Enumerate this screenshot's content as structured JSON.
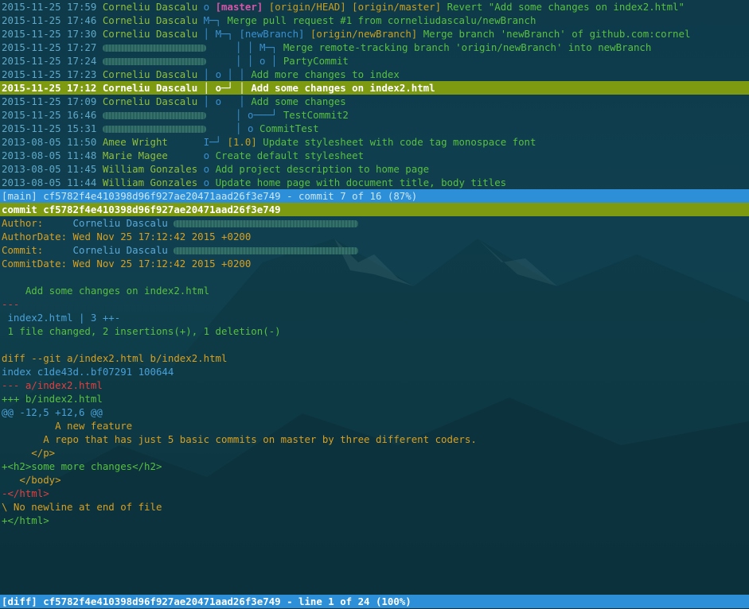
{
  "log": {
    "rows": [
      {
        "date": "2015-11-25 17:59",
        "author": "Corneliu Dascalu",
        "author_hidden": false,
        "graph": "o",
        "indent": "     ",
        "refs_head": "[master]",
        "refs": "[origin/HEAD] [origin/master]",
        "msg": "Revert \"Add some changes on index2.html\""
      },
      {
        "date": "2015-11-25 17:46",
        "author": "Corneliu Dascalu",
        "author_hidden": false,
        "graph": "M─┐",
        "indent": "     ",
        "refs_head": "",
        "refs": "",
        "msg": "Merge pull request #1 from corneliudascalu/newBranch"
      },
      {
        "date": "2015-11-25 17:30",
        "author": "Corneliu Dascalu",
        "author_hidden": false,
        "graph": "│ M─┐",
        "indent": "     ",
        "refs_head": "",
        "refs_blue": "[newBranch]",
        "refs": "[origin/newBranch]",
        "msg": "Merge branch 'newBranch' of github.com:cornel"
      },
      {
        "date": "2015-11-25 17:27",
        "author": "",
        "author_hidden": true,
        "graph": "│ │ M─┐",
        "indent": "     ",
        "refs_head": "",
        "refs": "",
        "msg": "Merge remote-tracking branch 'origin/newBranch' into newBranch"
      },
      {
        "date": "2015-11-25 17:24",
        "author": "",
        "author_hidden": true,
        "graph": "│ │ o │",
        "indent": "     ",
        "refs_head": "",
        "refs": "",
        "msg": "PartyCommit"
      },
      {
        "date": "2015-11-25 17:23",
        "author": "Corneliu Dascalu",
        "author_hidden": false,
        "graph": "│ o │ │",
        "indent": "     ",
        "refs_head": "",
        "refs": "",
        "msg": "Add more changes to index"
      },
      {
        "date": "2015-11-25 17:12",
        "author": "Corneliu Dascalu",
        "author_hidden": false,
        "graph": "│ o─┘ │",
        "indent": "     ",
        "refs_head": "",
        "refs": "",
        "msg": "Add some changes on index2.html",
        "selected": true
      },
      {
        "date": "2015-11-25 17:09",
        "author": "Corneliu Dascalu",
        "author_hidden": false,
        "graph": "│ o   │",
        "indent": "     ",
        "refs_head": "",
        "refs": "",
        "msg": "Add some changes"
      },
      {
        "date": "2015-11-25 16:46",
        "author": "",
        "author_hidden": true,
        "graph": "│ o───┘",
        "indent": "     ",
        "refs_head": "",
        "refs": "",
        "msg": "TestCommit2"
      },
      {
        "date": "2015-11-25 15:31",
        "author": "",
        "author_hidden": true,
        "graph": "│ o",
        "indent": "     ",
        "refs_head": "",
        "refs": "",
        "msg": "CommitTest"
      },
      {
        "date": "2013-08-05 11:50",
        "author": "Amee Wright",
        "author_hidden": false,
        "graph": "I─┘",
        "indent": "     ",
        "refs_head": "",
        "refs": "[1.0]",
        "msg": "Update stylesheet with code tag monospace font"
      },
      {
        "date": "2013-08-05 11:48",
        "author": "Marie Magee",
        "author_hidden": false,
        "graph": "o",
        "indent": "     ",
        "refs_head": "",
        "refs": "",
        "msg": "Create default stylesheet"
      },
      {
        "date": "2013-08-05 11:45",
        "author": "William Gonzales",
        "author_hidden": false,
        "graph": "o",
        "indent": "     ",
        "refs_head": "",
        "refs": "",
        "msg": "Add project description to home page"
      },
      {
        "date": "2013-08-05 11:44",
        "author": "William Gonzales",
        "author_hidden": false,
        "graph": "o",
        "indent": "     ",
        "refs_head": "",
        "refs": "",
        "msg": "Update home page with document title, body titles"
      }
    ]
  },
  "status_main": {
    "label": "[main] cf5782f4e410398d96f927ae20471aad26f3e749 - commit 7 of 16 (87%)"
  },
  "diff": {
    "commit_line": "commit cf5782f4e410398d96f927ae20471aad26f3e749",
    "author_label": "Author:",
    "author_name": "Corneliu Dascalu",
    "author_date_label": "AuthorDate:",
    "author_date": "Wed Nov 25 17:12:42 2015 +0200",
    "committer_label": "Commit:",
    "committer_name": "Corneliu Dascalu",
    "commit_date_label": "CommitDate:",
    "commit_date": "Wed Nov 25 17:12:42 2015 +0200",
    "message": "    Add some changes on index2.html",
    "sep": "---",
    "stat_file": " index2.html | 3 ++-",
    "stat_summary": " 1 file changed, 2 insertions(+), 1 deletion(-)",
    "diff_git": "diff --git a/index2.html b/index2.html",
    "index_line": "index c1de43d..bf07291 100644",
    "minus_file": "--- a/index2.html",
    "plus_file": "+++ b/index2.html",
    "hunk": "@@ -12,5 +12,6 @@",
    "ctx1": "         A new feature",
    "ctx2": "       A repo that has just 5 basic commits on master by three different coders.",
    "ctx3": "     </p>",
    "add1": "+<h2>some more changes</h2>",
    "ctx4": "   </body>",
    "del1": "-</html>",
    "nonewline": "\\ No newline at end of file",
    "add2": "+</html>"
  },
  "status_diff": {
    "label": "[diff] cf5782f4e410398d96f927ae20471aad26f3e749 - line 1 of 24 (100%)"
  }
}
